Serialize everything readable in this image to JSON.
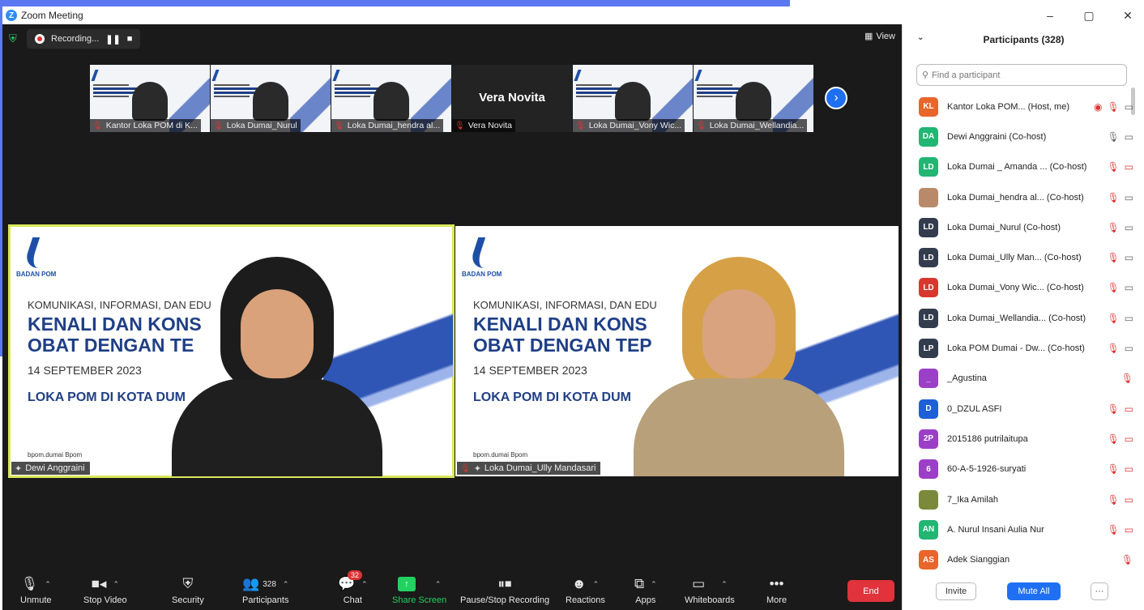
{
  "window": {
    "title": "Zoom Meeting",
    "controls": [
      "–",
      "▢",
      "✕"
    ]
  },
  "meeting": {
    "recording_label": "Recording...",
    "pause_glyph": "❚❚",
    "stop_glyph": "■",
    "view_label": "View",
    "thumbnails": [
      {
        "label": "Kantor Loka POM di K...",
        "kind": "slide"
      },
      {
        "label": "Loka Dumai_Nurul",
        "kind": "slide"
      },
      {
        "label": "Loka Dumai_hendra al...",
        "kind": "slide"
      },
      {
        "label": "Vera Novita",
        "kind": "name",
        "big_name": "Vera Novita"
      },
      {
        "label": "Loka Dumai_Vony Wic...",
        "kind": "slide"
      },
      {
        "label": "Loka Dumai_Wellandia...",
        "kind": "slide"
      }
    ],
    "slide": {
      "brand": "BADAN POM",
      "line1": "KOMUNIKASI, INFORMASI, DAN EDU",
      "line2": "KENALI DAN KONS",
      "line3": "OBAT DENGAN TE",
      "line3b": "OBAT DENGAN TEP",
      "line4": "14 SEPTEMBER 2023",
      "line5": "LOKA POM DI KOTA DUM",
      "line6": "bpom.dumai  Bpom"
    },
    "tiles": [
      {
        "name": "Dewi Anggraini"
      },
      {
        "name": "Loka Dumai_Ully Mandasari"
      }
    ]
  },
  "toolbar": {
    "unmute": "Unmute",
    "stop_video": "Stop Video",
    "security": "Security",
    "participants": "Participants",
    "participants_count": "328",
    "chat": "Chat",
    "chat_badge": "32",
    "share_screen": "Share Screen",
    "pause_stop_recording": "Pause/Stop Recording",
    "reactions": "Reactions",
    "apps": "Apps",
    "whiteboards": "Whiteboards",
    "more": "More",
    "end": "End"
  },
  "panel": {
    "title": "Participants (328)",
    "search_placeholder": "Find a participant",
    "participants": [
      {
        "initials": "KL",
        "color": "#e8652b",
        "name": "Kantor Loka POM... (Host, me)"
      },
      {
        "initials": "DA",
        "color": "#22b573",
        "name": "Dewi Anggraini (Co-host)"
      },
      {
        "initials": "LD",
        "color": "#22b573",
        "name": "Loka Dumai _ Amanda ... (Co-host)"
      },
      {
        "initials": "",
        "color": "#b88a6a",
        "name": "Loka Dumai_hendra al... (Co-host)"
      },
      {
        "initials": "LD",
        "color": "#333c4d",
        "name": "Loka Dumai_Nurul (Co-host)"
      },
      {
        "initials": "LD",
        "color": "#333c4d",
        "name": "Loka Dumai_Ully Man... (Co-host)"
      },
      {
        "initials": "LD",
        "color": "#d8372e",
        "name": "Loka Dumai_Vony Wic... (Co-host)"
      },
      {
        "initials": "LD",
        "color": "#333c4d",
        "name": "Loka Dumai_Wellandia... (Co-host)"
      },
      {
        "initials": "LP",
        "color": "#333c4d",
        "name": "Loka POM Dumai - Dw... (Co-host)"
      },
      {
        "initials": "_",
        "color": "#9b3fc7",
        "name": "_Agustina"
      },
      {
        "initials": "D",
        "color": "#1f5fd6",
        "name": "0_DZUL ASFI"
      },
      {
        "initials": "2P",
        "color": "#9b3fc7",
        "name": "2015186 putrilaitupa"
      },
      {
        "initials": "6",
        "color": "#9b3fc7",
        "name": "60-A-5-1926-suryati"
      },
      {
        "initials": "",
        "color": "#7a8a3a",
        "name": "7_Ika Amilah"
      },
      {
        "initials": "AN",
        "color": "#22b573",
        "name": "A. Nurul Insani Aulia Nur"
      },
      {
        "initials": "AS",
        "color": "#e8652b",
        "name": "Adek Sianggian"
      }
    ],
    "invite": "Invite",
    "mute_all": "Mute All",
    "more": "···"
  }
}
